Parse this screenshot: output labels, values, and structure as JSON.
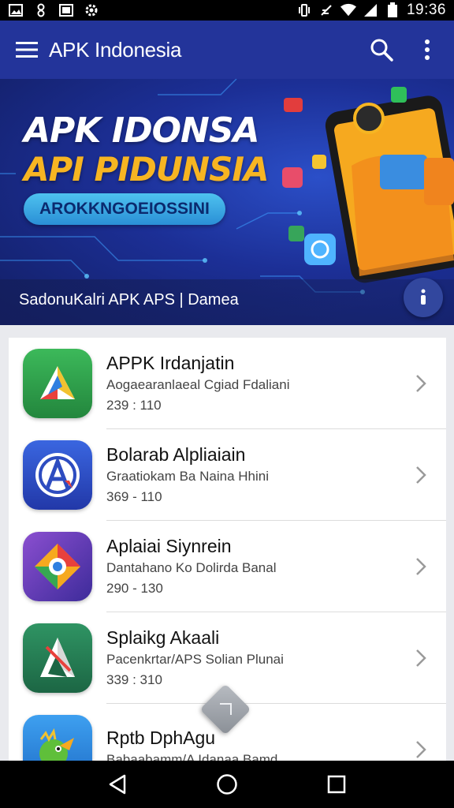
{
  "status_bar": {
    "time": "19:36",
    "left_icons": [
      "image-icon",
      "link-icon",
      "gallery-icon",
      "settings-icon"
    ],
    "right_icons": [
      "vibrate-icon",
      "no-signal-icon",
      "wifi-icon",
      "cell-signal-icon",
      "battery-icon"
    ]
  },
  "app_bar": {
    "title": "APK Indonesia",
    "icons": [
      "menu-icon",
      "search-icon",
      "more-vert-icon"
    ]
  },
  "banner": {
    "headline_1": "APK IDONSA",
    "headline_2": "API PIDUNSIA",
    "pill_label": "AROKKNGOEIOSSINI",
    "caption": "SadonuKalri APK APS | Damea",
    "fab_icon": "info-icon"
  },
  "apps": [
    {
      "title": "APPK Irdanjatin",
      "subtitle": "Aogaearanlaeal Cgiad Fdaliani",
      "meta": "239 : 110",
      "icon": "triangle-logo-icon",
      "color": "#2e9c48"
    },
    {
      "title": "Bolarab Alpliaiain",
      "subtitle": "Graatiokam Ba Naina Hhini",
      "meta": "369 - 110",
      "icon": "compass-a-logo-icon",
      "color": "#2d4cc0"
    },
    {
      "title": "Aplaiai Siynrein",
      "subtitle": "Dantahano Ko Dolirda Banal",
      "meta": "290 - 130",
      "icon": "map-pin-logo-icon",
      "color": "#6b3fb0"
    },
    {
      "title": "Splaikg Akaali",
      "subtitle": "Pacenkrtar/APS Solian Plunai",
      "meta": "339 : 310",
      "icon": "letter-a-logo-icon",
      "color": "#237a55"
    },
    {
      "title": "Rptb DphAgu",
      "subtitle": "Babaabamm/A Idanaa Bamd",
      "meta": "",
      "icon": "parrot-logo-icon",
      "color": "#2a86d8"
    }
  ],
  "nav_bar": {
    "icons": [
      "back-icon",
      "home-icon",
      "recents-icon"
    ]
  },
  "colors": {
    "app_bar": "#23349a",
    "banner_accent": "#f7b522",
    "pill": "#4ec2ef"
  }
}
